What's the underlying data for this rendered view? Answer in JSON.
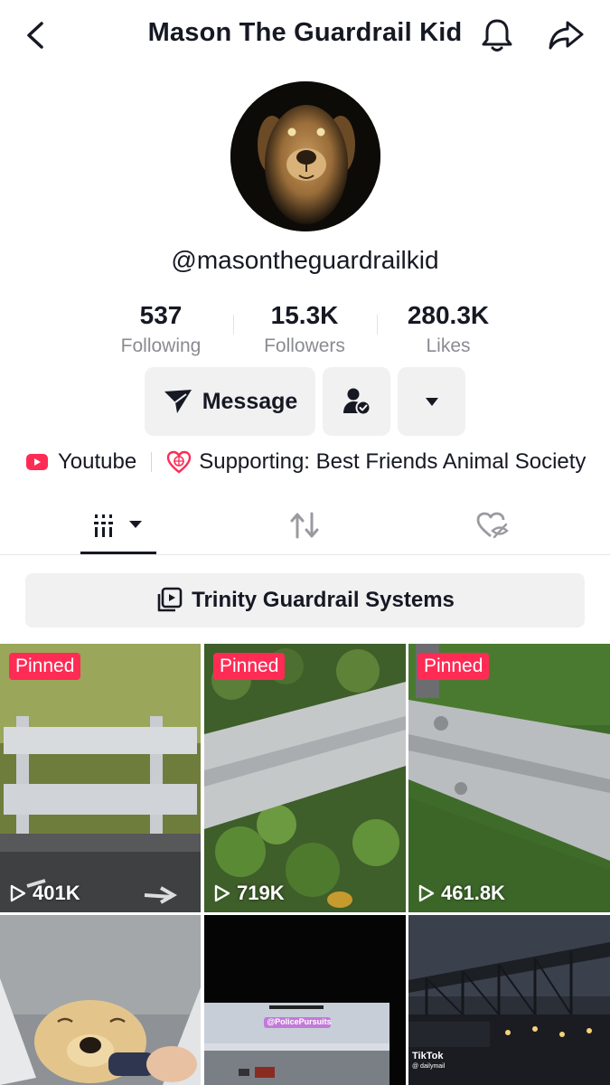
{
  "header": {
    "title": "Mason The Guardrail Kid",
    "back_icon": "chevron-left-icon",
    "bell_icon": "bell-icon",
    "share_icon": "share-arrow-icon"
  },
  "profile": {
    "handle": "@masontheguardrailkid",
    "stats": [
      {
        "value": "537",
        "label": "Following"
      },
      {
        "value": "15.3K",
        "label": "Followers"
      },
      {
        "value": "280.3K",
        "label": "Likes"
      }
    ]
  },
  "actions": {
    "message_label": "Message"
  },
  "links": {
    "youtube_label": "Youtube",
    "supporting_label": "Supporting: Best Friends Animal Society"
  },
  "playlist": {
    "label": "Trinity Guardrail Systems"
  },
  "videos": [
    {
      "pinned": "Pinned",
      "views": "401K"
    },
    {
      "pinned": "Pinned",
      "views": "719K"
    },
    {
      "pinned": "Pinned",
      "views": "461.8K"
    }
  ],
  "thumb_text": {
    "police": "@PolicePursuits",
    "tiktok": "TikTok",
    "dailymail": "@ dailymail"
  },
  "colors": {
    "accent": "#fe2c55",
    "text": "#161823",
    "muted": "#8a8b91",
    "button_bg": "#f1f1f2"
  }
}
